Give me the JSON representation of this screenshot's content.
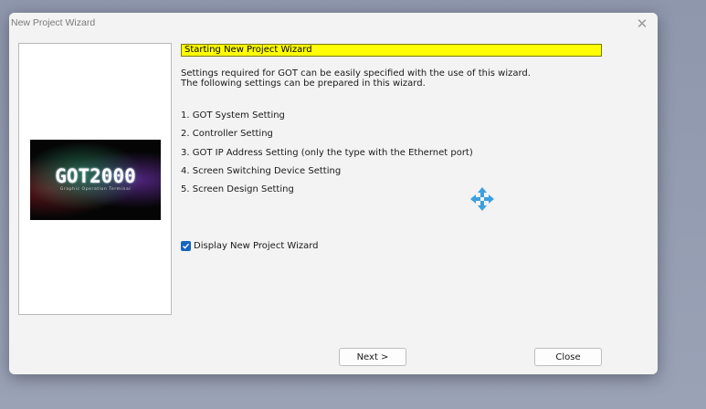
{
  "window": {
    "title": "New Project Wizard",
    "close_glyph": "✕"
  },
  "logo": {
    "text": "GOT2000",
    "subtitle": "Graphic Operation Terminal"
  },
  "content": {
    "heading": "Starting New Project Wizard",
    "description_line1": "Settings required for GOT can be easily specified with the use of this wizard.",
    "description_line2": "The following settings can be prepared in this wizard.",
    "steps": [
      "1. GOT System Setting",
      "2. Controller Setting",
      "3. GOT IP Address Setting (only the type with the Ethernet port)",
      "4. Screen Switching Device Setting",
      "5. Screen Design Setting"
    ]
  },
  "checkbox": {
    "label": "Display New Project Wizard",
    "checked": true
  },
  "buttons": {
    "next_label": "Next >",
    "close_label": "Close"
  },
  "colors": {
    "heading_highlight": "#ffff00",
    "checkbox_accent": "#1565c0",
    "move_icon": "#3c9fe0"
  },
  "icons": {
    "move": "move-arrows-icon",
    "check": "checkmark-icon"
  }
}
